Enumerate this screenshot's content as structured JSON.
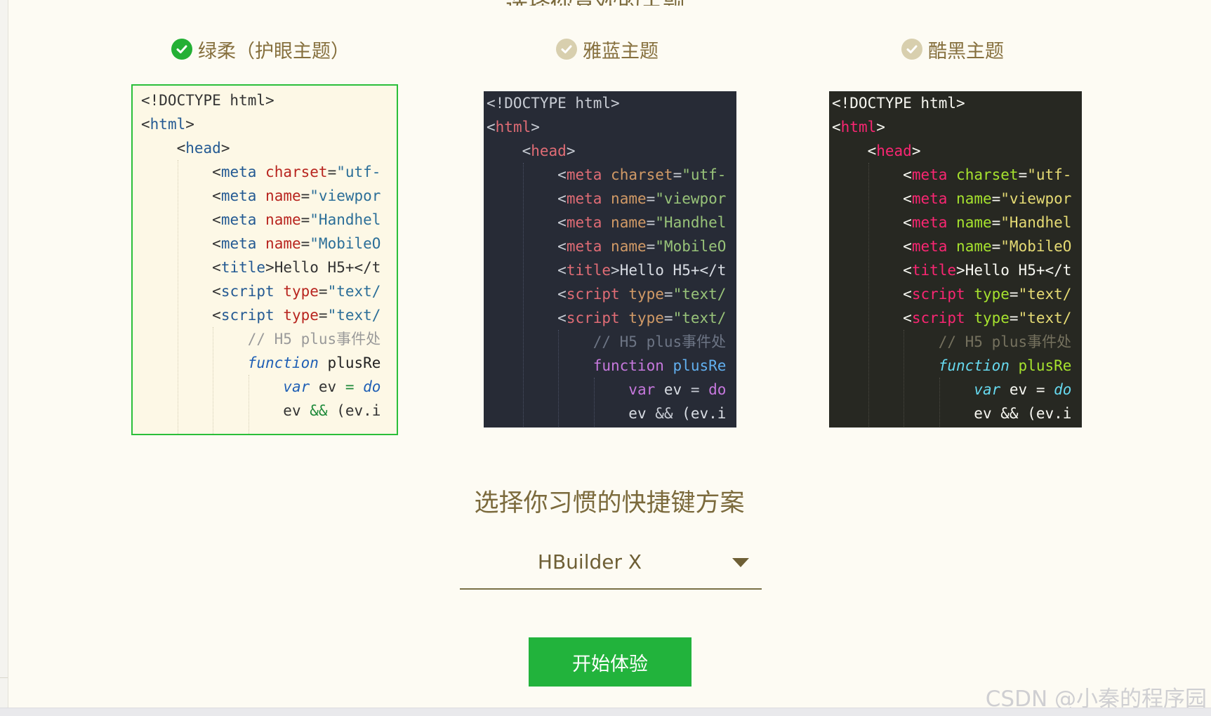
{
  "top_heading_fragment": "选择你喜欢的主题",
  "themes": [
    {
      "id": "green",
      "label": "绿柔（护眼主题）",
      "selected": true
    },
    {
      "id": "blue",
      "label": "雅蓝主题",
      "selected": false
    },
    {
      "id": "black",
      "label": "酷黑主题",
      "selected": false
    }
  ],
  "code_preview": [
    [
      [
        "punct",
        "<!DOCTYPE html>"
      ]
    ],
    [
      [
        "punct",
        "<"
      ],
      [
        "tag",
        "html"
      ],
      [
        "punct",
        ">"
      ]
    ],
    [
      [
        "text",
        "    "
      ],
      [
        "punct",
        "<"
      ],
      [
        "tag",
        "head"
      ],
      [
        "punct",
        ">"
      ]
    ],
    [
      [
        "text",
        "        "
      ],
      [
        "punct",
        "<"
      ],
      [
        "tag",
        "meta"
      ],
      [
        "text",
        " "
      ],
      [
        "attr",
        "charset"
      ],
      [
        "punct",
        "="
      ],
      [
        "str",
        "\"utf-"
      ]
    ],
    [
      [
        "text",
        "        "
      ],
      [
        "punct",
        "<"
      ],
      [
        "tag",
        "meta"
      ],
      [
        "text",
        " "
      ],
      [
        "attr2",
        "name"
      ],
      [
        "punct",
        "="
      ],
      [
        "str",
        "\"viewpor"
      ]
    ],
    [
      [
        "text",
        "        "
      ],
      [
        "punct",
        "<"
      ],
      [
        "tag",
        "meta"
      ],
      [
        "text",
        " "
      ],
      [
        "attr2",
        "name"
      ],
      [
        "punct",
        "="
      ],
      [
        "str",
        "\"Handhel"
      ]
    ],
    [
      [
        "text",
        "        "
      ],
      [
        "punct",
        "<"
      ],
      [
        "tag",
        "meta"
      ],
      [
        "text",
        " "
      ],
      [
        "attr2",
        "name"
      ],
      [
        "punct",
        "="
      ],
      [
        "str",
        "\"MobileO"
      ]
    ],
    [
      [
        "text",
        "        "
      ],
      [
        "punct",
        "<"
      ],
      [
        "tag",
        "title"
      ],
      [
        "punct",
        ">"
      ],
      [
        "text",
        "Hello H5+</t"
      ]
    ],
    [
      [
        "text",
        "        "
      ],
      [
        "punct",
        "<"
      ],
      [
        "tag",
        "script"
      ],
      [
        "text",
        " "
      ],
      [
        "attr2",
        "type"
      ],
      [
        "punct",
        "="
      ],
      [
        "str",
        "\"text/"
      ]
    ],
    [
      [
        "text",
        "        "
      ],
      [
        "punct",
        "<"
      ],
      [
        "tag",
        "script"
      ],
      [
        "text",
        " "
      ],
      [
        "attr2",
        "type"
      ],
      [
        "punct",
        "="
      ],
      [
        "str",
        "\"text/"
      ]
    ],
    [
      [
        "text",
        "            "
      ],
      [
        "comment",
        "// H5 plus事件处"
      ]
    ],
    [
      [
        "text",
        "            "
      ],
      [
        "kw",
        "function"
      ],
      [
        "text",
        " "
      ],
      [
        "fn",
        "plusRe"
      ]
    ],
    [
      [
        "text",
        "                "
      ],
      [
        "kw",
        "var"
      ],
      [
        "text",
        " ev "
      ],
      [
        "op",
        "="
      ],
      [
        "text",
        " "
      ],
      [
        "kw",
        "do"
      ]
    ],
    [
      [
        "text",
        "                "
      ],
      [
        "text",
        "ev "
      ],
      [
        "op",
        "&&"
      ],
      [
        "text",
        " (ev.i"
      ]
    ]
  ],
  "shortcut": {
    "title": "选择你习惯的快捷键方案",
    "selected": "HBuilder X"
  },
  "start_button": "开始体验",
  "watermark": "CSDN @小秦的程序园",
  "colors": {
    "accent_green": "#22b33c",
    "heading_brown": "#7b6a3c",
    "page_bg": "#fdfbf3"
  }
}
